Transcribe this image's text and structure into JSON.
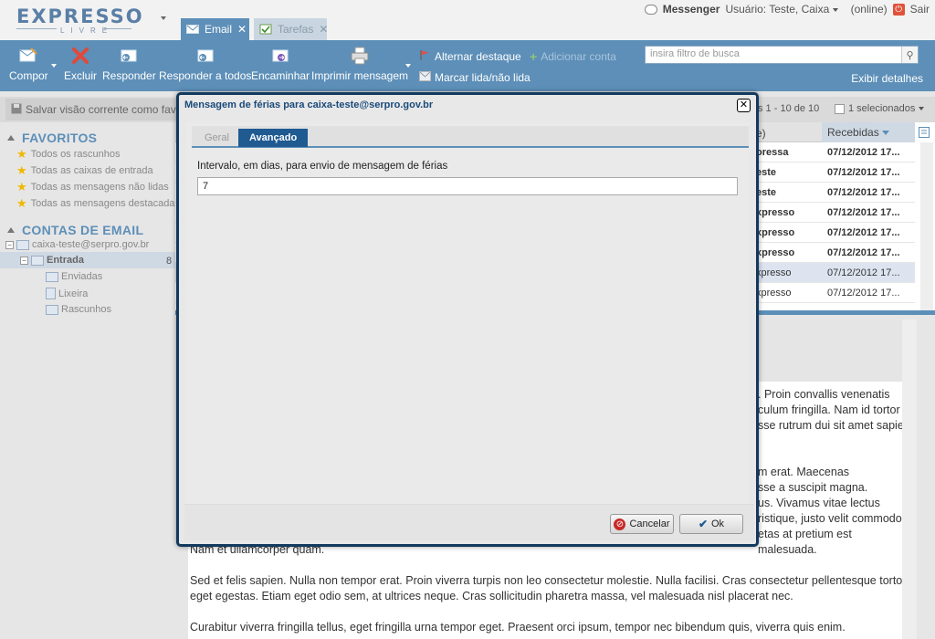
{
  "app": {
    "logo": {
      "word": "EXPRESSO",
      "sub": "LIVRE"
    },
    "tabs": [
      {
        "label": "Email",
        "close": "✕"
      },
      {
        "label": "Tarefas",
        "close": "✕"
      }
    ],
    "top_right": {
      "messenger": "Messenger",
      "user": "Usuário: Teste, Caixa",
      "status": "(online)",
      "logout": "Sair"
    }
  },
  "toolbar": {
    "compose": "Compor",
    "delete": "Excluir",
    "reply": "Responder",
    "reply_all": "Responder a todos",
    "forward": "Encaminhar",
    "print": "Imprimir mensagem",
    "toggle_flag": "Alternar destaque",
    "add_account": "Adicionar conta",
    "mark_read": "Marcar lida/não lida",
    "search_placeholder": "insira filtro de busca",
    "details": "Exibir detalhes"
  },
  "subbar": {
    "save_view": "Salvar visão corrente como favorito",
    "paging": "s 1 - 10 de 10",
    "selected": "1 selecionados"
  },
  "sidebar": {
    "favorites_title": "FAVORITOS",
    "favorites": [
      "Todos os rascunhos",
      "Todas as caixas de entrada",
      "Todas as mensagens não lidas",
      "Todas as mensagens destacadas"
    ],
    "accounts_title": "CONTAS DE EMAIL",
    "account": "caixa-teste@serpro.gov.br",
    "inbox": "Entrada",
    "inbox_count": "8",
    "folders": [
      "Enviadas",
      "Lixeira",
      "Rascunhos"
    ]
  },
  "message_list": {
    "col_from": "e)",
    "col_received": "Recebidas",
    "rows": [
      {
        "from": "oressa",
        "date": "07/12/2012 17...",
        "bold": true,
        "selected": false
      },
      {
        "from": "este",
        "date": "07/12/2012 17...",
        "bold": true,
        "selected": false
      },
      {
        "from": "este",
        "date": "07/12/2012 17...",
        "bold": true,
        "selected": false
      },
      {
        "from": "xpresso",
        "date": "07/12/2012 17...",
        "bold": true,
        "selected": false
      },
      {
        "from": "xpresso",
        "date": "07/12/2012 17...",
        "bold": true,
        "selected": false
      },
      {
        "from": "xpresso",
        "date": "07/12/2012 17...",
        "bold": true,
        "selected": false
      },
      {
        "from": "xpresso",
        "date": "07/12/2012 17...",
        "bold": false,
        "selected": true
      },
      {
        "from": "xpresso",
        "date": "07/12/2012 17...",
        "bold": false,
        "selected": false
      }
    ]
  },
  "preview": {
    "lines_a": [
      ". Proin convallis venenatis",
      "culum fringilla. Nam id tortor et",
      "sse rutrum dui sit amet sapien"
    ],
    "lines_b": [
      "m erat. Maecenas",
      "sse a suscipit magna.",
      "us. Vivamus vitae lectus",
      "ristique, justo velit commodo",
      "etas at pretium est malesuada."
    ],
    "para_1": "Nam et ullamcorper quam.",
    "para_2": "Sed et felis sapien. Nulla non tempor erat. Proin viverra turpis non leo consectetur molestie. Nulla facilisi. Cras consectetur pellentesque tortor eget egestas. Etiam eget odio sem, at ultrices neque. Cras sollicitudin pharetra massa, vel malesuada nisl placerat nec.",
    "para_3": "Curabitur viverra fringilla tellus, eget fringilla urna tempor eget. Praesent orci ipsum, tempor nec bibendum quis, viverra quis enim."
  },
  "dialog": {
    "title": "Mensagem de férias para caixa-teste@serpro.gov.br",
    "close": "✕",
    "tab_general": "Geral",
    "tab_advanced": "Avançado",
    "interval_label": "Intervalo, em dias, para envio de mensagem de férias",
    "interval_value": "7",
    "cancel": "Cancelar",
    "ok": "Ok"
  },
  "colors": {
    "accent": "#5d8fb8",
    "dialog_border": "#123a5e",
    "tab_active": "#1f5a91"
  }
}
